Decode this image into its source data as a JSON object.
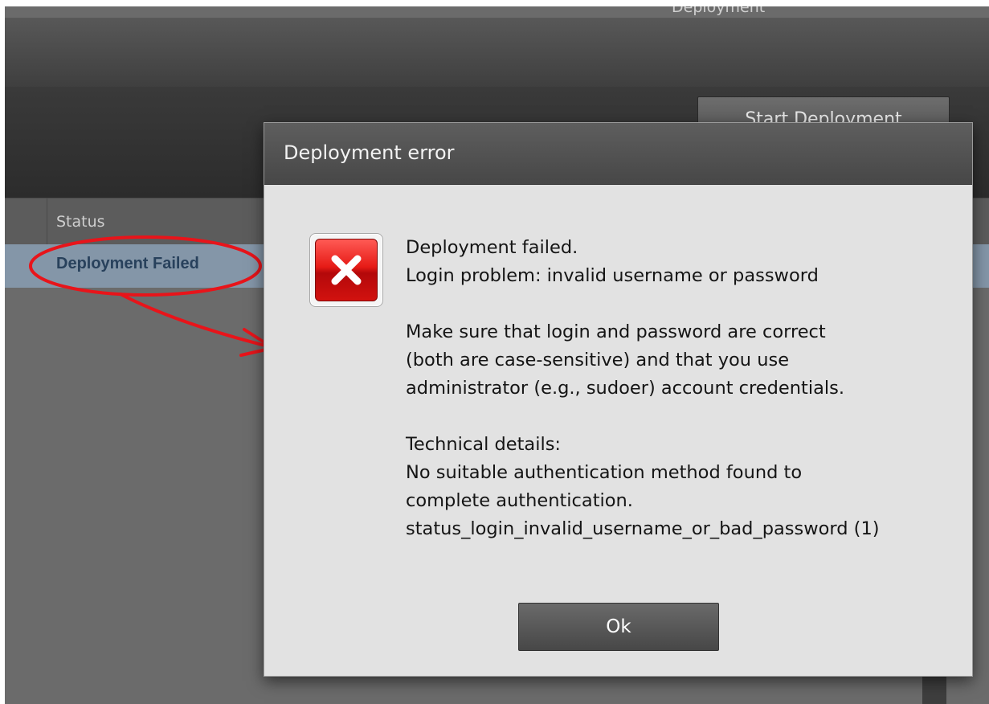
{
  "app": {
    "window_title": "Deployment",
    "start_button_label": "Start Deployment",
    "grid": {
      "status_column_header": "Status",
      "selected_row_status": "Deployment Failed"
    }
  },
  "dialog": {
    "title": "Deployment error",
    "icon": "error-x-icon",
    "message_lines": [
      "Deployment failed.",
      "Login problem: invalid username or password",
      "",
      "Make sure that login and password are correct",
      "(both are case-sensitive) and that you use",
      "administrator (e.g., sudoer) account credentials.",
      "",
      "Technical details:",
      "No suitable authentication method found to",
      "complete authentication.",
      "status_login_invalid_username_or_bad_password (1)"
    ],
    "ok_label": "Ok"
  },
  "colors": {
    "annotation": "#e8141a",
    "error_red": "#e61b16",
    "selected_row": "#8496a8"
  }
}
